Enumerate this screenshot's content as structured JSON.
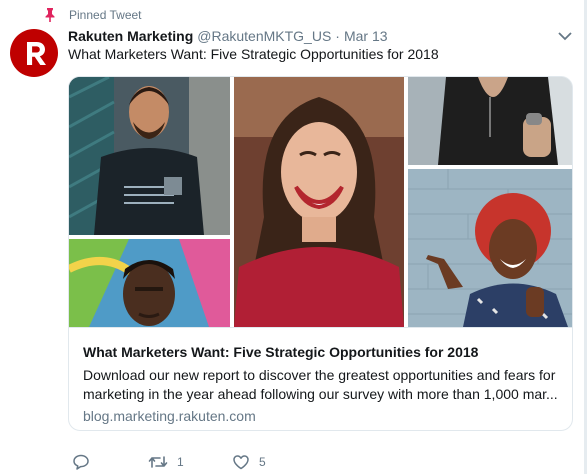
{
  "pinned": {
    "label": "Pinned Tweet",
    "icon": "pin-icon"
  },
  "author": {
    "avatar_letter": "R",
    "avatar_color": "#bf0000",
    "name": "Rakuten Marketing",
    "handle": "@RakutenMKTG_US",
    "separator": "·",
    "date": "Mar 13"
  },
  "tweet": {
    "text": "What Marketers Want: Five Strategic Opportunities for 2018"
  },
  "card": {
    "title": "What Marketers Want: Five Strategic Opportunities for 2018",
    "description_line1": "Download our new report to discover the greatest opportunities and fears for",
    "description_line2": "marketing in the year ahead following our survey with more than 1,000 mar...",
    "domain": "blog.marketing.rakuten.com"
  },
  "actions": {
    "reply": {
      "icon": "reply-icon",
      "count": ""
    },
    "retweet": {
      "icon": "retweet-icon",
      "count": "1"
    },
    "like": {
      "icon": "heart-icon",
      "count": "5"
    }
  },
  "colors": {
    "accent": "#1da1f2",
    "secondary_text": "#657786",
    "border": "#e1e8ed",
    "pin": "#e0245e"
  }
}
